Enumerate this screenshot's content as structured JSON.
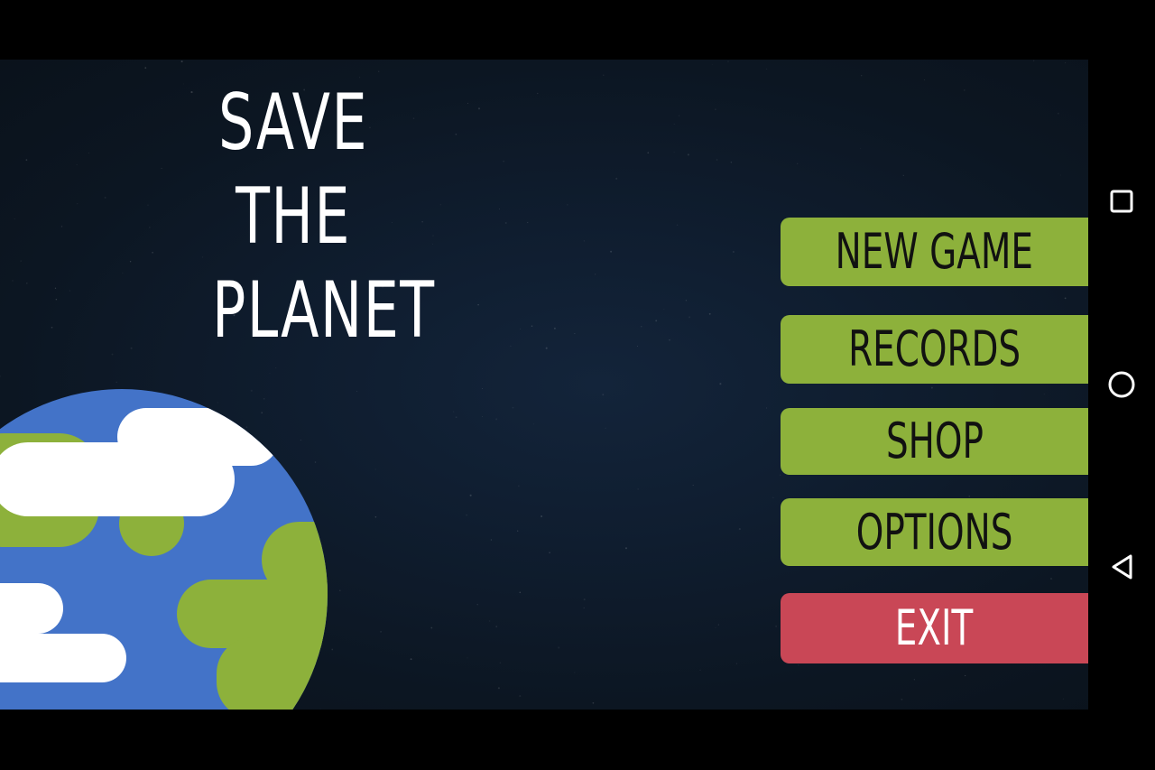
{
  "game": {
    "title_lines": [
      "SAVE",
      "THE",
      "PLANET"
    ]
  },
  "menu": {
    "new_game": "NEW GAME",
    "records": "RECORDS",
    "shop": "SHOP",
    "options": "OPTIONS",
    "exit": "EXIT"
  },
  "colors": {
    "background": "#0e1a29",
    "menu_green": "#8db13b",
    "exit_red": "#c94756",
    "planet_ocean": "#4373c8",
    "planet_land": "#8db13b",
    "cloud": "#ffffff"
  },
  "nav_bar": {
    "icons": [
      "recents-square-icon",
      "home-circle-icon",
      "back-triangle-icon"
    ]
  }
}
